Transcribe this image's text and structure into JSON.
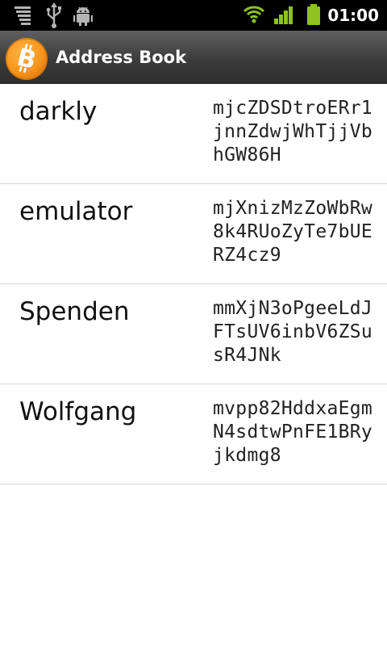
{
  "status_bar": {
    "time": "01:00",
    "icons": [
      "notification-stack-icon",
      "usb-icon",
      "android-debug-icon",
      "wifi-icon",
      "signal-icon",
      "battery-icon"
    ]
  },
  "action_bar": {
    "title": "Address Book",
    "logo_icon": "bitcoin-logo-icon",
    "logo_color": "#f7931a"
  },
  "address_book": {
    "entries": [
      {
        "label": "darkly",
        "address": "mjcZDSDtroERr1jnnZdwjWhTjjVbhGW86H"
      },
      {
        "label": "emulator",
        "address": "mjXnizMzZoWbRw8k4RUoZyTe7bUERZ4cz9"
      },
      {
        "label": "Spenden",
        "address": "mmXjN3oPgeeLdJFTsUV6inbV6ZSusR4JNk"
      },
      {
        "label": "Wolfgang",
        "address": "mvpp82HddxaEgmN4sdtwPnFE1BRyjkdmg8"
      }
    ]
  },
  "colors": {
    "status_icon_gray": "#b4b4b4",
    "status_icon_green": "#8ec21f",
    "action_bar": "#3c3c3c",
    "divider": "#d9d9d9"
  }
}
